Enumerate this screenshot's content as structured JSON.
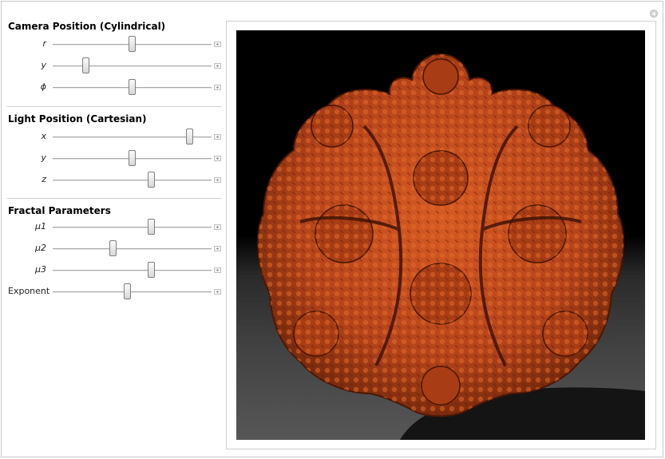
{
  "sections": {
    "camera": {
      "title": "Camera Position (Cylindrical)",
      "controls": [
        {
          "label": "r",
          "value": 0.5
        },
        {
          "label": "y",
          "value": 0.21
        },
        {
          "label": "ϕ",
          "value": 0.5
        }
      ]
    },
    "light": {
      "title": "Light Position (Cartesian)",
      "controls": [
        {
          "label": "x",
          "value": 0.86
        },
        {
          "label": "y",
          "value": 0.5
        },
        {
          "label": "z",
          "value": 0.62
        }
      ]
    },
    "fractal": {
      "title": "Fractal Parameters",
      "controls": [
        {
          "label": "μ1",
          "value": 0.62
        },
        {
          "label": "μ2",
          "value": 0.38
        },
        {
          "label": "μ3",
          "value": 0.62
        },
        {
          "label": "Exponent",
          "value": 0.47
        }
      ]
    }
  },
  "colors": {
    "fractal": "#c24a1c",
    "fractal_shadow": "#6a2008",
    "background_top": "#000000",
    "floor": "#555555"
  }
}
